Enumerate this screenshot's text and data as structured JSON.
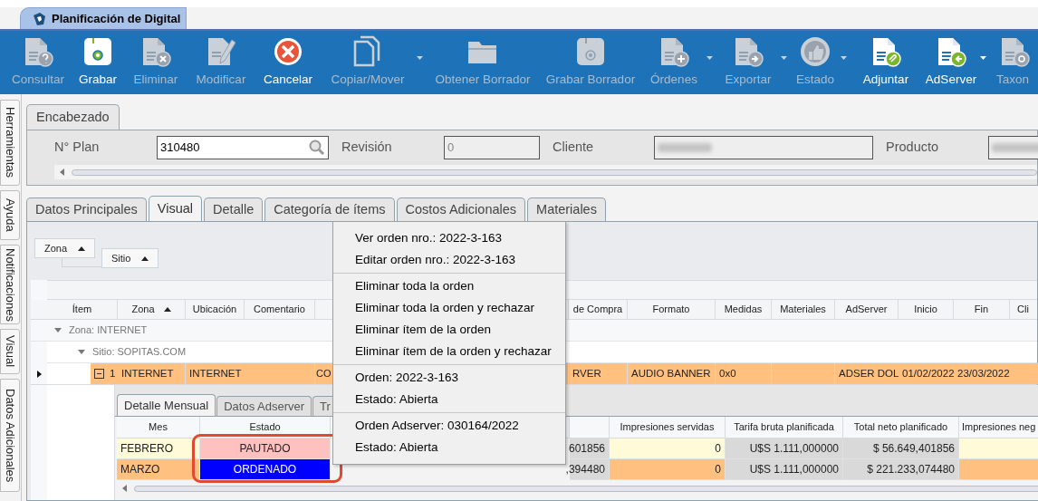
{
  "app_tab": {
    "title": "Planificación de Digital"
  },
  "toolbar": [
    {
      "label": "Consultar",
      "kind": "doc-question",
      "enabled": false,
      "dropdown": false
    },
    {
      "label": "Grabar",
      "kind": "save",
      "enabled": true,
      "dropdown": false
    },
    {
      "label": "Eliminar",
      "kind": "doc-delete",
      "enabled": false,
      "dropdown": false
    },
    {
      "label": "Modificar",
      "kind": "doc-edit",
      "enabled": false,
      "dropdown": false
    },
    {
      "label": "Cancelar",
      "kind": "cancel",
      "enabled": true,
      "dropdown": false
    },
    {
      "label": "Copiar/Mover",
      "kind": "copy",
      "enabled": false,
      "dropdown": true
    },
    {
      "label": "Obtener Borrador",
      "kind": "folder",
      "enabled": false,
      "dropdown": false
    },
    {
      "label": "Grabar Borrador",
      "kind": "save",
      "enabled": false,
      "dropdown": false
    },
    {
      "label": "Órdenes",
      "kind": "doc-add",
      "enabled": false,
      "dropdown": true
    },
    {
      "label": "Exportar",
      "kind": "doc-export",
      "enabled": false,
      "dropdown": true
    },
    {
      "label": "Estado",
      "kind": "thumb",
      "enabled": false,
      "dropdown": true
    },
    {
      "label": "Adjuntar",
      "kind": "doc-attach",
      "enabled": true,
      "dropdown": false
    },
    {
      "label": "AdServer",
      "kind": "doc-import",
      "enabled": true,
      "dropdown": true
    },
    {
      "label": "Taxon",
      "kind": "doc-gear",
      "enabled": false,
      "dropdown": false
    }
  ],
  "side_tabs": [
    {
      "label": "Herramientas"
    },
    {
      "label": "Ayuda"
    },
    {
      "label": "Notificaciones"
    },
    {
      "label": "Visual"
    },
    {
      "label": "Datos Adicionales"
    }
  ],
  "header": {
    "tab": "Encabezado",
    "fields": [
      {
        "label": "N° Plan",
        "value": "310480",
        "kind": "search"
      },
      {
        "label": "Revisión",
        "value": "0",
        "kind": "readonly"
      },
      {
        "label": "Cliente",
        "kind": "blurred"
      },
      {
        "label": "Producto",
        "kind": "blurred"
      }
    ]
  },
  "tabs": [
    {
      "label": "Datos Principales",
      "selected": false
    },
    {
      "label": "Visual",
      "selected": true
    },
    {
      "label": "Detalle",
      "selected": false
    },
    {
      "label": "Categoría de ítems",
      "selected": false
    },
    {
      "label": "Costos Adicionales",
      "selected": false
    },
    {
      "label": "Materiales",
      "selected": false
    }
  ],
  "grid": {
    "group_by": [
      {
        "label": "Zona",
        "sort_ascending": true
      },
      {
        "label": "Sitio",
        "sort_ascending": true
      }
    ],
    "columns": [
      {
        "label": "Ítem"
      },
      {
        "label": "Zona",
        "sort_ascending": true
      },
      {
        "label": "Ubicación"
      },
      {
        "label": "Comentario"
      },
      {},
      {
        "label": "de Compra"
      },
      {
        "label": "Formato"
      },
      {
        "label": "Medidas"
      },
      {
        "label": "Materiales"
      },
      {
        "label": "AdServer"
      },
      {
        "label": "Inicio"
      },
      {
        "label": "Fin"
      },
      {
        "label": "Cli"
      }
    ],
    "groups": [
      {
        "label": "Zona: INTERNET",
        "expanded": true,
        "children": [
          {
            "label": "Sitio: SOPITAS.COM",
            "expanded": true
          }
        ]
      }
    ],
    "row": {
      "current": true,
      "expanded": true,
      "color": "#ffc080",
      "cells": [
        "1",
        "INTERNET",
        "INTERNET",
        null,
        "CO",
        "RVER",
        "AUDIO BANNER",
        "0x0",
        null,
        "ADSER DOL",
        "01/02/2022",
        "23/03/2022",
        null
      ]
    },
    "detail": {
      "tabs": [
        {
          "label": "Detalle Mensual",
          "selected": true
        },
        {
          "label": "Datos Adserver",
          "selected": false
        },
        {
          "label": "Tr",
          "selected": false
        }
      ],
      "columns": [
        {
          "label": "Mes"
        },
        {
          "label": "Estado"
        },
        {},
        {},
        {
          "label": "Impresiones servidas"
        },
        {
          "label": "Tarifa bruta planificada"
        },
        {
          "label": "Total neto planificado"
        },
        {
          "label": "Impresiones neg"
        }
      ],
      "highlight_estado": true,
      "rows": [
        {
          "color": "#fffbd8",
          "status": {
            "label": "PAUTADO",
            "color": "#ffc0c0"
          },
          "cells": [
            "FEBRERO",
            null,
            null,
            "601856",
            "0",
            "U$S 1.111,000000",
            "$ 56.649,401856",
            null
          ]
        },
        {
          "color": "#ffc080",
          "status": {
            "label": "ORDENADO",
            "color": "#0000ff"
          },
          "cells": [
            "MARZO",
            null,
            null,
            ",394480",
            "0",
            "U$S 1.111,000000",
            "$ 221.233,074480",
            null
          ]
        }
      ]
    }
  },
  "context_menu": {
    "sections": [
      {
        "items": [
          "Ver orden nro.: 2022-3-163",
          "Editar orden nro.: 2022-3-163"
        ]
      },
      {
        "items": [
          "Eliminar toda la orden",
          "Eliminar toda la orden y rechazar",
          "Eliminar ítem de la orden",
          "Eliminar ítem de la orden y rechazar"
        ]
      },
      {
        "items": [
          "Orden: 2022-3-163",
          "Estado: Abierta"
        ]
      },
      {
        "items": [
          "Orden Adserver: 030164/2022",
          "Estado: Abierta"
        ]
      }
    ]
  }
}
